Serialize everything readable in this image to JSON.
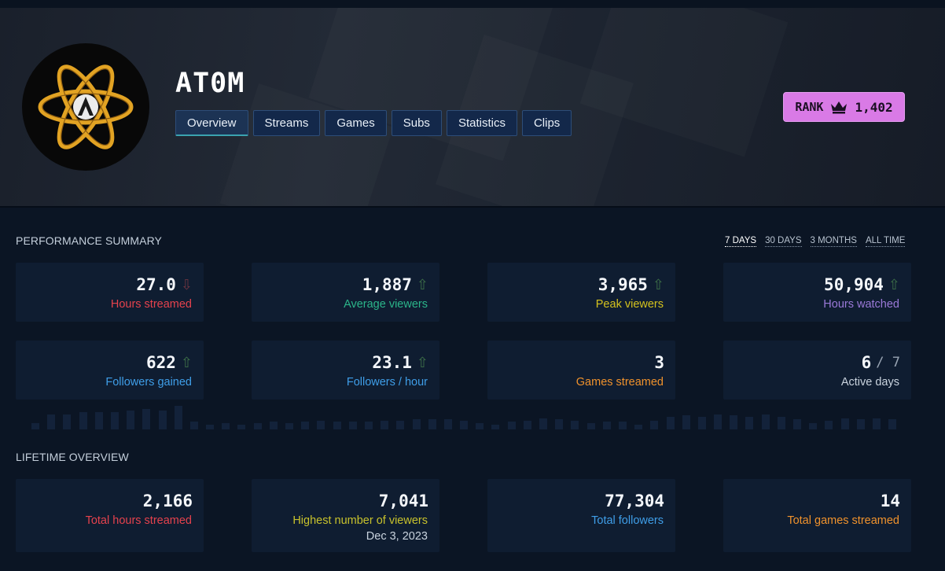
{
  "channel": {
    "name": "AT0M"
  },
  "tabs": [
    {
      "label": "Overview",
      "active": true
    },
    {
      "label": "Streams"
    },
    {
      "label": "Games"
    },
    {
      "label": "Subs"
    },
    {
      "label": "Statistics"
    },
    {
      "label": "Clips"
    }
  ],
  "rank": {
    "label": "RANK",
    "value": "1,402",
    "icon": "crown-icon"
  },
  "performance": {
    "title": "PERFORMANCE SUMMARY",
    "ranges": [
      {
        "label": "7 DAYS",
        "active": true
      },
      {
        "label": "30 DAYS"
      },
      {
        "label": "3 MONTHS"
      },
      {
        "label": "ALL TIME"
      }
    ],
    "cards": [
      {
        "value": "27.0",
        "label": "Hours streamed",
        "trend": "down",
        "color": "#e5424d"
      },
      {
        "value": "1,887",
        "label": "Average viewers",
        "trend": "up",
        "color": "#2bb58a"
      },
      {
        "value": "3,965",
        "label": "Peak viewers",
        "trend": "up",
        "color": "#d4c21e"
      },
      {
        "value": "50,904",
        "label": "Hours watched",
        "trend": "up",
        "color": "#9a79d8"
      },
      {
        "value": "622",
        "label": "Followers gained",
        "trend": "up",
        "color": "#3f9ee8"
      },
      {
        "value": "23.1",
        "label": "Followers / hour",
        "trend": "up",
        "color": "#3f9ee8"
      },
      {
        "value": "3",
        "label": "Games streamed",
        "color": "#f0922c"
      },
      {
        "value": "6",
        "of": "/ 7",
        "label": "Active days",
        "color": "#c9d3de"
      }
    ],
    "activity_levels": [
      0.25,
      0.6,
      0.6,
      0.7,
      0.7,
      0.7,
      0.75,
      0.8,
      0.75,
      0.95,
      0.3,
      0.2,
      0.25,
      0.2,
      0.25,
      0.3,
      0.25,
      0.3,
      0.35,
      0.3,
      0.3,
      0.3,
      0.35,
      0.35,
      0.4,
      0.4,
      0.4,
      0.35,
      0.25,
      0.2,
      0.3,
      0.35,
      0.45,
      0.4,
      0.35,
      0.25,
      0.3,
      0.3,
      0.2,
      0.35,
      0.5,
      0.55,
      0.5,
      0.6,
      0.55,
      0.5,
      0.6,
      0.5,
      0.4,
      0.25,
      0.35,
      0.45,
      0.4,
      0.45,
      0.4
    ]
  },
  "lifetime": {
    "title": "LIFETIME OVERVIEW",
    "cards": [
      {
        "value": "2,166",
        "label": "Total hours streamed",
        "color": "#e5424d"
      },
      {
        "value": "7,041",
        "label": "Highest number of viewers",
        "sub": "Dec 3, 2023",
        "color": "#c8c22c"
      },
      {
        "value": "77,304",
        "label": "Total followers",
        "color": "#3f9ee8"
      },
      {
        "value": "14",
        "label": "Total games streamed",
        "color": "#f0922c"
      }
    ]
  }
}
